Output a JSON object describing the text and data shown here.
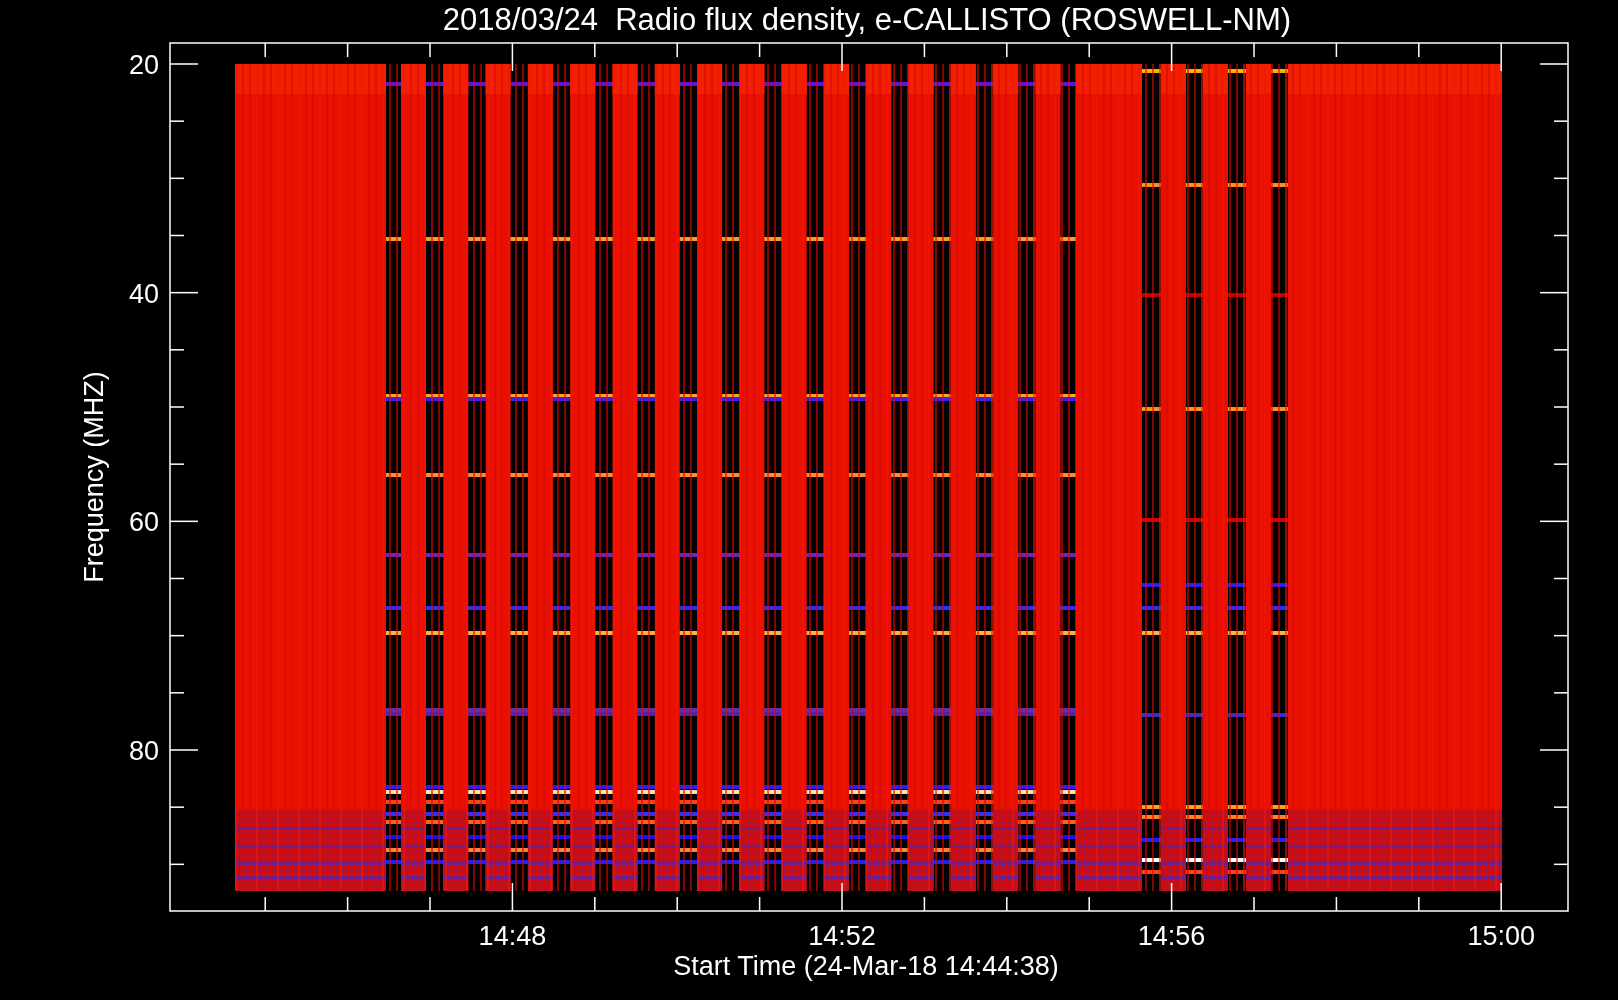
{
  "title": "2018/03/24  Radio flux density, e-CALLISTO (ROSWELL-NM)",
  "y_axis": {
    "label": "Frequency (MHZ)",
    "ticks": [
      "20",
      "40",
      "60",
      "80"
    ]
  },
  "x_axis": {
    "label": "Start Time (24-Mar-18 14:44:38)",
    "ticks": [
      "14:48",
      "14:52",
      "14:56",
      "15:00"
    ]
  }
}
